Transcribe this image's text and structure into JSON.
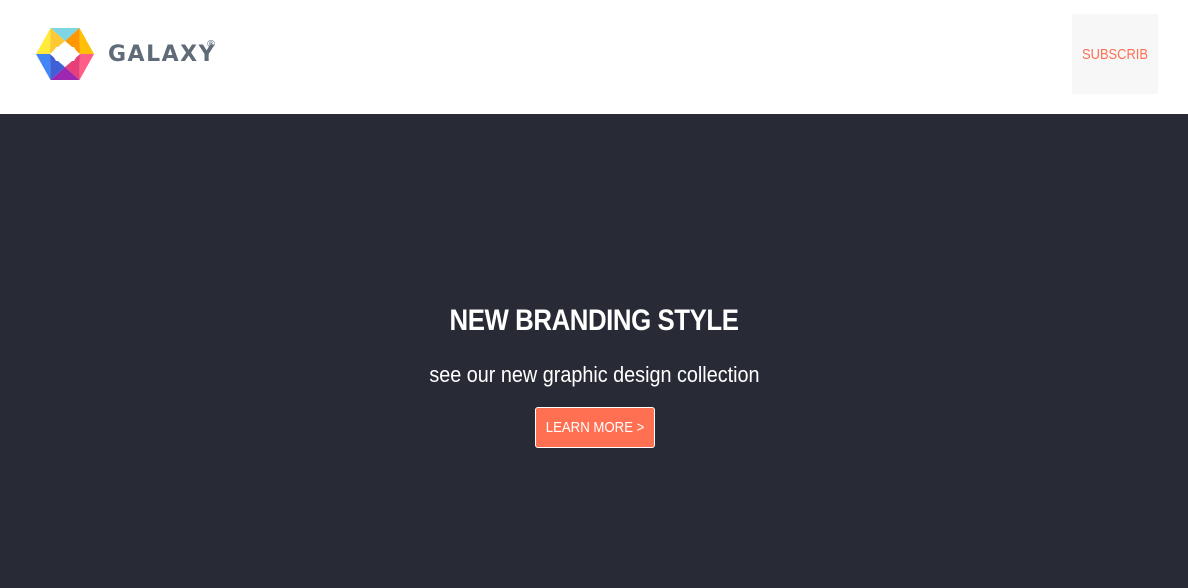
{
  "header": {
    "logo_text": "GALAXY",
    "logo_mark": "®",
    "subscribe_label": "SUBSCRIB"
  },
  "hero": {
    "title": "NEW BRANDING STYLE",
    "subtitle": "see our new graphic design collection",
    "cta_label": "LEARN MORE >"
  },
  "colors": {
    "accent": "#ff6f52",
    "hero_background": "#282b35",
    "logo_text": "#5f6b78",
    "subscribe_background": "#f7f7f7"
  },
  "icons": {
    "logo": "hexagon-logo-icon"
  }
}
